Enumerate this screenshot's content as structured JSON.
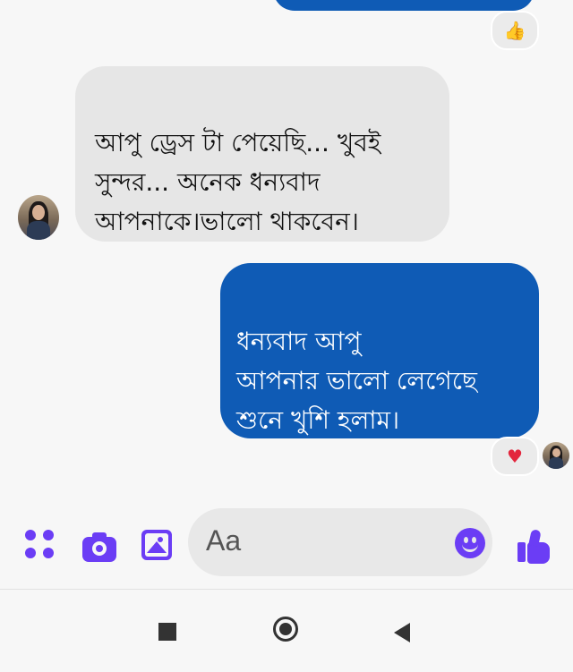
{
  "messages": {
    "previous_reaction": "👍",
    "incoming": {
      "text": "আপু ড্রেস টা পেয়েছি... খুবই\nসুন্দর... অনেক ধন্যবাদ\nআপনাকে।ভালো থাকবেন।"
    },
    "outgoing": {
      "text": "ধন্যবাদ আপু\nআপনার ভালো লেগেছে\nশুনে খুশি হলাম।",
      "reaction": "♥"
    }
  },
  "composer": {
    "placeholder": "Aa",
    "icons": [
      "apps-icon",
      "camera-icon",
      "gallery-icon",
      "emoji-icon",
      "like-icon"
    ],
    "accent": "#6b3df5"
  },
  "colors": {
    "outgoing_bubble": "#0f5bb5",
    "incoming_bubble": "#e6e6e6"
  }
}
